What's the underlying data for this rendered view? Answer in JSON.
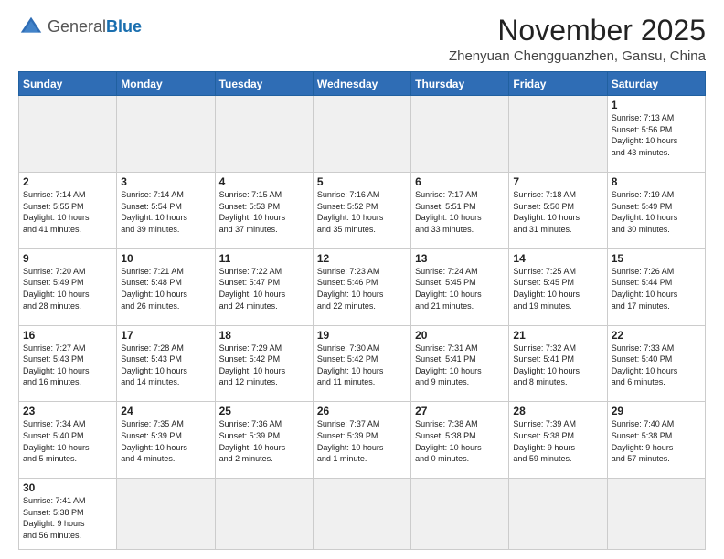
{
  "logo": {
    "general": "General",
    "blue": "Blue"
  },
  "header": {
    "month": "November 2025",
    "location": "Zhenyuan Chengguanzhen, Gansu, China"
  },
  "weekdays": [
    "Sunday",
    "Monday",
    "Tuesday",
    "Wednesday",
    "Thursday",
    "Friday",
    "Saturday"
  ],
  "days": [
    {
      "num": "",
      "info": "",
      "empty": true
    },
    {
      "num": "",
      "info": "",
      "empty": true
    },
    {
      "num": "",
      "info": "",
      "empty": true
    },
    {
      "num": "",
      "info": "",
      "empty": true
    },
    {
      "num": "",
      "info": "",
      "empty": true
    },
    {
      "num": "",
      "info": "",
      "empty": true
    },
    {
      "num": "1",
      "info": "Sunrise: 7:13 AM\nSunset: 5:56 PM\nDaylight: 10 hours\nand 43 minutes.",
      "empty": false
    }
  ],
  "rows": [
    [
      {
        "num": "2",
        "info": "Sunrise: 7:14 AM\nSunset: 5:55 PM\nDaylight: 10 hours\nand 41 minutes."
      },
      {
        "num": "3",
        "info": "Sunrise: 7:14 AM\nSunset: 5:54 PM\nDaylight: 10 hours\nand 39 minutes."
      },
      {
        "num": "4",
        "info": "Sunrise: 7:15 AM\nSunset: 5:53 PM\nDaylight: 10 hours\nand 37 minutes."
      },
      {
        "num": "5",
        "info": "Sunrise: 7:16 AM\nSunset: 5:52 PM\nDaylight: 10 hours\nand 35 minutes."
      },
      {
        "num": "6",
        "info": "Sunrise: 7:17 AM\nSunset: 5:51 PM\nDaylight: 10 hours\nand 33 minutes."
      },
      {
        "num": "7",
        "info": "Sunrise: 7:18 AM\nSunset: 5:50 PM\nDaylight: 10 hours\nand 31 minutes."
      },
      {
        "num": "8",
        "info": "Sunrise: 7:19 AM\nSunset: 5:49 PM\nDaylight: 10 hours\nand 30 minutes."
      }
    ],
    [
      {
        "num": "9",
        "info": "Sunrise: 7:20 AM\nSunset: 5:49 PM\nDaylight: 10 hours\nand 28 minutes."
      },
      {
        "num": "10",
        "info": "Sunrise: 7:21 AM\nSunset: 5:48 PM\nDaylight: 10 hours\nand 26 minutes."
      },
      {
        "num": "11",
        "info": "Sunrise: 7:22 AM\nSunset: 5:47 PM\nDaylight: 10 hours\nand 24 minutes."
      },
      {
        "num": "12",
        "info": "Sunrise: 7:23 AM\nSunset: 5:46 PM\nDaylight: 10 hours\nand 22 minutes."
      },
      {
        "num": "13",
        "info": "Sunrise: 7:24 AM\nSunset: 5:45 PM\nDaylight: 10 hours\nand 21 minutes."
      },
      {
        "num": "14",
        "info": "Sunrise: 7:25 AM\nSunset: 5:45 PM\nDaylight: 10 hours\nand 19 minutes."
      },
      {
        "num": "15",
        "info": "Sunrise: 7:26 AM\nSunset: 5:44 PM\nDaylight: 10 hours\nand 17 minutes."
      }
    ],
    [
      {
        "num": "16",
        "info": "Sunrise: 7:27 AM\nSunset: 5:43 PM\nDaylight: 10 hours\nand 16 minutes."
      },
      {
        "num": "17",
        "info": "Sunrise: 7:28 AM\nSunset: 5:43 PM\nDaylight: 10 hours\nand 14 minutes."
      },
      {
        "num": "18",
        "info": "Sunrise: 7:29 AM\nSunset: 5:42 PM\nDaylight: 10 hours\nand 12 minutes."
      },
      {
        "num": "19",
        "info": "Sunrise: 7:30 AM\nSunset: 5:42 PM\nDaylight: 10 hours\nand 11 minutes."
      },
      {
        "num": "20",
        "info": "Sunrise: 7:31 AM\nSunset: 5:41 PM\nDaylight: 10 hours\nand 9 minutes."
      },
      {
        "num": "21",
        "info": "Sunrise: 7:32 AM\nSunset: 5:41 PM\nDaylight: 10 hours\nand 8 minutes."
      },
      {
        "num": "22",
        "info": "Sunrise: 7:33 AM\nSunset: 5:40 PM\nDaylight: 10 hours\nand 6 minutes."
      }
    ],
    [
      {
        "num": "23",
        "info": "Sunrise: 7:34 AM\nSunset: 5:40 PM\nDaylight: 10 hours\nand 5 minutes."
      },
      {
        "num": "24",
        "info": "Sunrise: 7:35 AM\nSunset: 5:39 PM\nDaylight: 10 hours\nand 4 minutes."
      },
      {
        "num": "25",
        "info": "Sunrise: 7:36 AM\nSunset: 5:39 PM\nDaylight: 10 hours\nand 2 minutes."
      },
      {
        "num": "26",
        "info": "Sunrise: 7:37 AM\nSunset: 5:39 PM\nDaylight: 10 hours\nand 1 minute."
      },
      {
        "num": "27",
        "info": "Sunrise: 7:38 AM\nSunset: 5:38 PM\nDaylight: 10 hours\nand 0 minutes."
      },
      {
        "num": "28",
        "info": "Sunrise: 7:39 AM\nSunset: 5:38 PM\nDaylight: 9 hours\nand 59 minutes."
      },
      {
        "num": "29",
        "info": "Sunrise: 7:40 AM\nSunset: 5:38 PM\nDaylight: 9 hours\nand 57 minutes."
      }
    ],
    [
      {
        "num": "30",
        "info": "Sunrise: 7:41 AM\nSunset: 5:38 PM\nDaylight: 9 hours\nand 56 minutes.",
        "last": true
      },
      {
        "num": "",
        "info": "",
        "empty": true,
        "last": true
      },
      {
        "num": "",
        "info": "",
        "empty": true,
        "last": true
      },
      {
        "num": "",
        "info": "",
        "empty": true,
        "last": true
      },
      {
        "num": "",
        "info": "",
        "empty": true,
        "last": true
      },
      {
        "num": "",
        "info": "",
        "empty": true,
        "last": true
      },
      {
        "num": "",
        "info": "",
        "empty": true,
        "last": true
      }
    ]
  ]
}
